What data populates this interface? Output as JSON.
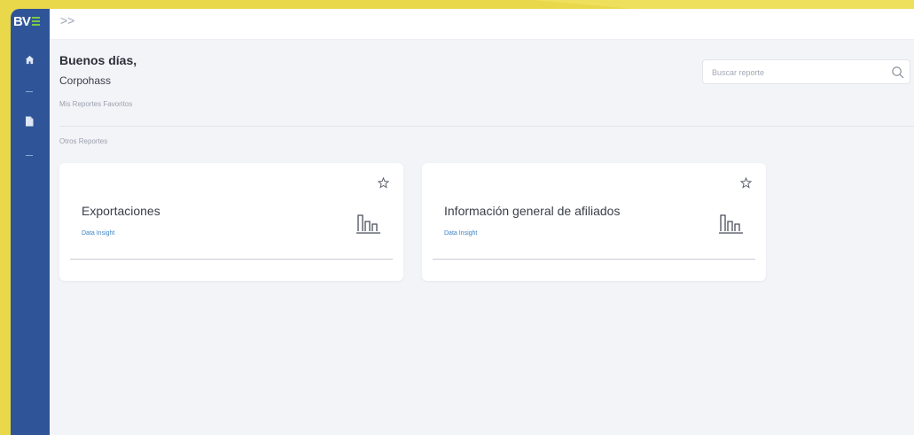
{
  "brand": {
    "logo_text": "BV",
    "accent": "#7ac943",
    "sidebar_color": "#2f5598",
    "frame_color": "#e9d84a"
  },
  "sidebar": {
    "items": [
      {
        "icon": "home-icon"
      },
      {
        "icon": "dash-icon"
      },
      {
        "icon": "document-icon"
      },
      {
        "icon": "dash-icon"
      }
    ]
  },
  "topbar": {
    "expand_label": ">>"
  },
  "greeting": {
    "title": "Buenos días,",
    "user": "Corpohass"
  },
  "sections": {
    "favorites_label": "Mis Reportes Favoritos",
    "others_label": "Otros Reportes"
  },
  "search": {
    "placeholder": "Buscar reporte",
    "value": ""
  },
  "cards": [
    {
      "title": "Exportaciones",
      "source": "Data Insight",
      "icon": "bar-chart-icon"
    },
    {
      "title": "Información general de afiliados",
      "source": "Data Insight",
      "icon": "bar-chart-icon"
    }
  ]
}
